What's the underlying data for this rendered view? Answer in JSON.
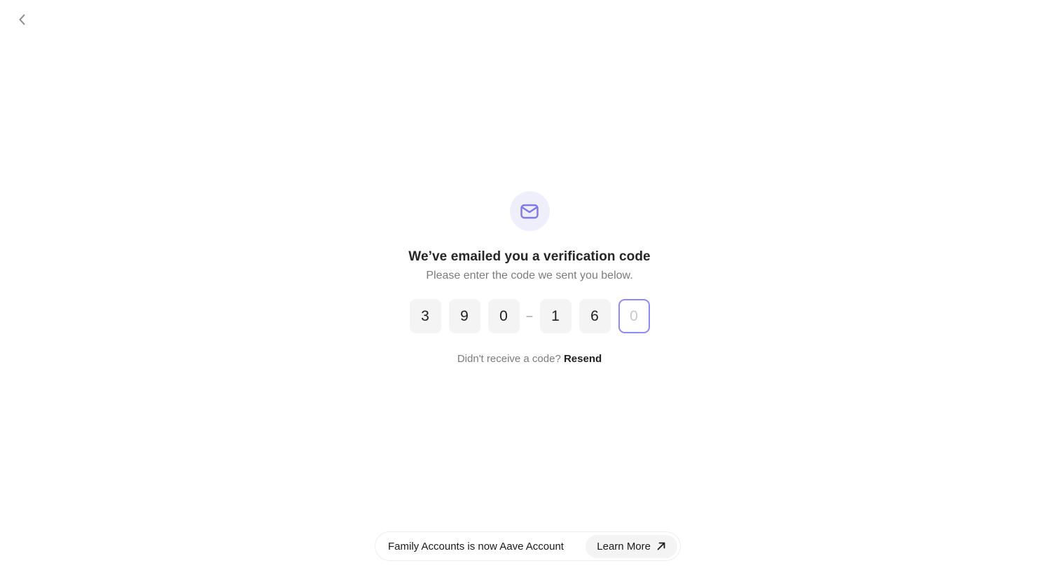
{
  "nav": {
    "back_icon": "chevron-left-icon"
  },
  "verify": {
    "icon": "mail-icon",
    "title": "We’ve emailed you a verification code",
    "subtitle": "Please enter the code we sent you below.",
    "code_digits": [
      "3",
      "9",
      "0",
      "1",
      "6",
      ""
    ],
    "separator": "–",
    "active_placeholder": "0",
    "resend_prompt": "Didn't receive a code?",
    "resend_label": "Resend"
  },
  "banner": {
    "text": "Family Accounts is now Aave Account",
    "button_label": "Learn More",
    "button_icon": "arrow-up-right-icon"
  },
  "colors": {
    "accent": "#8f8af0",
    "accent_bg": "#efeffb",
    "box_bg": "#f4f4f5"
  }
}
